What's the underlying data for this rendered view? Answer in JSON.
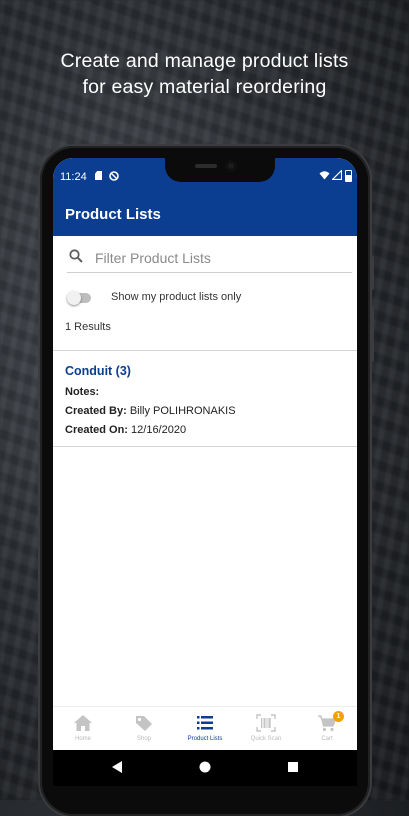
{
  "promo": {
    "line1": "Create and manage product lists",
    "line2": "for easy material reordering"
  },
  "status_bar": {
    "time": "11:24",
    "icons": [
      "sim-card-icon",
      "do-not-disturb-icon",
      "wifi-icon",
      "signal-icon",
      "battery-icon"
    ]
  },
  "app_bar": {
    "title": "Product Lists"
  },
  "search": {
    "placeholder": "Filter Product Lists",
    "value": ""
  },
  "toggle": {
    "label": "Show my product lists only",
    "on": false
  },
  "results": {
    "text": "1 Results"
  },
  "lists": [
    {
      "title": "Conduit (3)",
      "notes_label": "Notes:",
      "notes_value": "",
      "created_by_label": "Created By:",
      "created_by_value": "Billy POLIHRONAKIS",
      "created_on_label": "Created On:",
      "created_on_value": "12/16/2020"
    }
  ],
  "bottom_nav": [
    {
      "label": "Home",
      "icon": "home-icon",
      "active": false
    },
    {
      "label": "Shop",
      "icon": "tag-icon",
      "active": false
    },
    {
      "label": "Product Lists",
      "icon": "list-icon",
      "active": true
    },
    {
      "label": "Quick Scan",
      "icon": "barcode-scan-icon",
      "active": false
    },
    {
      "label": "Cart",
      "icon": "cart-icon",
      "active": false,
      "badge": "1"
    }
  ],
  "colors": {
    "primary": "#0b3d91",
    "badge": "#f2a100",
    "inactive_nav": "#b9b9b9"
  }
}
